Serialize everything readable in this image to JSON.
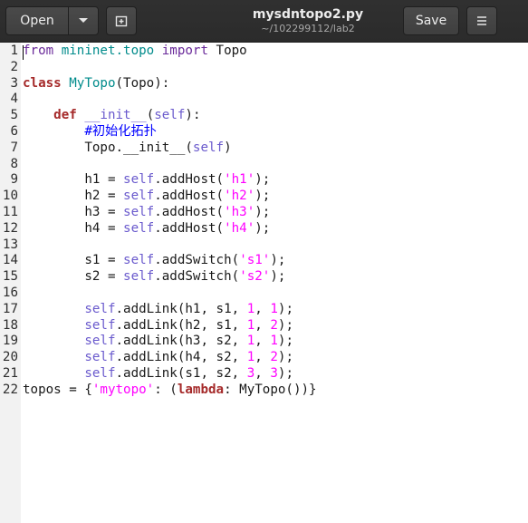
{
  "header": {
    "open_label": "Open",
    "save_label": "Save",
    "title": "mysdntopo2.py",
    "subtitle": "~/102299112/lab2",
    "icons": {
      "open_dropdown": "chevron-down-icon",
      "new_tab": "new-tab-icon",
      "menu": "hamburger-menu-icon"
    }
  },
  "editor": {
    "language": "python",
    "line_numbers": [
      "1",
      "2",
      "3",
      "4",
      "5",
      "6",
      "7",
      "8",
      "9",
      "10",
      "11",
      "12",
      "13",
      "14",
      "15",
      "16",
      "17",
      "18",
      "19",
      "20",
      "21",
      "22"
    ],
    "lines": [
      "from mininet.topo import Topo",
      "",
      "class MyTopo(Topo):",
      "",
      "    def __init__(self):",
      "        #初始化拓扑",
      "        Topo.__init__(self)",
      "",
      "        h1 = self.addHost('h1');",
      "        h2 = self.addHost('h2');",
      "        h3 = self.addHost('h3');",
      "        h4 = self.addHost('h4');",
      "",
      "        s1 = self.addSwitch('s1');",
      "        s2 = self.addSwitch('s2');",
      "",
      "        self.addLink(h1, s1, 1, 1);",
      "        self.addLink(h2, s1, 1, 2);",
      "        self.addLink(h3, s2, 1, 1);",
      "        self.addLink(h4, s2, 1, 2);",
      "        self.addLink(s1, s2, 3, 3);",
      "topos = {'mytopo': (lambda: MyTopo())}"
    ]
  },
  "colors": {
    "header_bg": "#2d2d2d",
    "keyword": "#a52a2a",
    "string": "#ff00ff",
    "self": "#6a5acd",
    "comment": "#0000ff"
  }
}
